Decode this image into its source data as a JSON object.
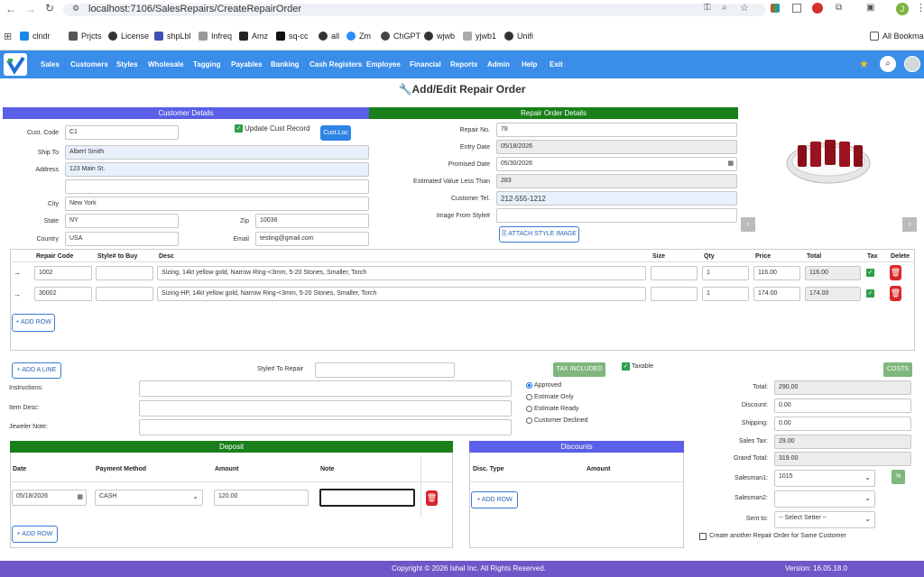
{
  "browser": {
    "url": "localhost:7106/SalesRepairs/CreateRepairOrder",
    "bookmarks": [
      "clndr",
      "Prjcts",
      "License",
      "shpLbl",
      "Infreq",
      "Amz",
      "sq-cc",
      "all",
      "Zm",
      "ChGPT",
      "wjwb",
      "yjwb1",
      "Unifi"
    ],
    "all_bookmarks": "All Bookmarks",
    "avatar_letter": "J"
  },
  "nav": {
    "items": [
      "Sales",
      "Customers",
      "Styles",
      "Wholesale",
      "Tagging",
      "Payables",
      "Banking",
      "Cash Registers",
      "Employee",
      "Financial",
      "Reports",
      "Admin",
      "Help",
      "Exit"
    ]
  },
  "page": {
    "title": "Add/Edit Repair Order"
  },
  "customer": {
    "header": "Customer Details",
    "cust_code_label": "Cust. Code",
    "cust_code": "C1",
    "update_label": "Update Cust Record",
    "custloc_button": "Cust.Loc",
    "ship_to_label": "Ship To",
    "ship_to": "Albert Smith",
    "address_label": "Address",
    "address": "123 Main St.",
    "address2": "",
    "city_label": "City",
    "city": "New York",
    "state_label": "State",
    "state": "NY",
    "zip_label": "Zip",
    "zip": "10036",
    "country_label": "Country",
    "country": "USA",
    "email_label": "Email",
    "email": "testing@gmail.com"
  },
  "repair": {
    "header": "Repair Order Details",
    "repair_no_label": "Repair No.",
    "repair_no": "78",
    "entry_date_label": "Entry Date",
    "entry_date": "05/18/2026",
    "promised_label": "Promised Date",
    "promised": "05/30/2026",
    "est_label": "Estimated Value Less Than",
    "est": "283",
    "tel_label": "Customer Tel.",
    "tel": "212-555-1212",
    "image_label": "Image From Style#",
    "image_style": "",
    "attach_button": "ATTACH STYLE IMAGE"
  },
  "items_table": {
    "headers": [
      "Repair Code",
      "Style# to Buy",
      "Desc",
      "Size",
      "Qty",
      "Price",
      "Total",
      "Tax",
      "Delete"
    ],
    "rows": [
      {
        "code": "1002",
        "style": "",
        "desc": "Sizing, 14kt yellow gold, Narrow Ring-<3mm, 5-20 Stones, Smaller, Torch",
        "size": "",
        "qty": "1",
        "price": "116.00",
        "total": "116.00"
      },
      {
        "code": "30002",
        "style": "",
        "desc": "Sizing-HP, 14kt yellow gold, Narrow Ring-<3mm, 5-20 Stones, Smaller, Torch",
        "size": "",
        "qty": "1",
        "price": "174.00",
        "total": "174.00"
      }
    ],
    "add_row": "+ ADD ROW"
  },
  "mid": {
    "add_line": "+ ADD A LINE",
    "style_to_repair_label": "Style# To Repair",
    "tax_included": "TAX INCLUDED",
    "taxable": "Taxable",
    "costs": "COSTS",
    "instructions_label": "Instructions:",
    "item_desc_label": "Item Desc:",
    "jeweler_note_label": "Jeweler Note:",
    "status_options": [
      "Approved",
      "Estimate Only",
      "Estimate Ready",
      "Customer Declined"
    ]
  },
  "deposit": {
    "header": "Deposit",
    "headers": [
      "Date",
      "Payment Method",
      "Amount",
      "Note"
    ],
    "date": "05/18/2026",
    "method": "CASH",
    "amount": "120.00",
    "note": "",
    "add_row": "+ ADD ROW"
  },
  "discounts": {
    "header": "Discounts",
    "headers": [
      "Disc. Type",
      "Amount"
    ],
    "add_row": "+ ADD ROW"
  },
  "totals": {
    "total_label": "Total:",
    "total": "290.00",
    "discount_label": "Discount:",
    "discount": "0.00",
    "shipping_label": "Shipping:",
    "shipping": "0.00",
    "sales_tax_label": "Sales Tax:",
    "sales_tax": "29.00",
    "grand_label": "Grand Total:",
    "grand": "319.00",
    "salesman1_label": "Salesman1:",
    "salesman1": "1015",
    "salesman2_label": "Salesman2:",
    "salesman2": "",
    "sent_to_label": "Sent to:",
    "sent_to": "-- Select Setter --",
    "pct_button": "%",
    "create_another": "Create another Repair Order for Same Customer"
  },
  "footer": {
    "copyright": "Copyright © 2026 Ishal Inc. All Rights Reserved.",
    "version": "Version: 16.05.18.0"
  },
  "colors": {
    "nav": "#3a8de8",
    "customer_header": "#5b5ee6",
    "repair_header": "#1a7f1a",
    "footer": "#6f57c7"
  }
}
